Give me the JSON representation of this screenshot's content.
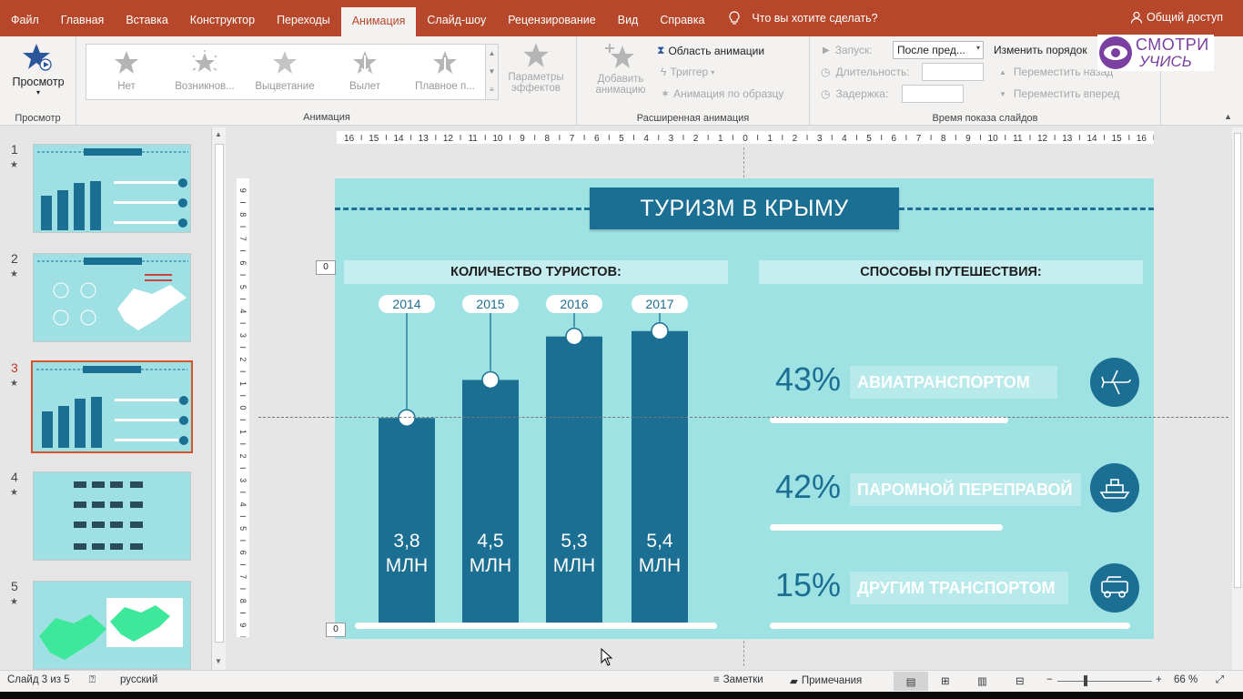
{
  "tabs": [
    "Файл",
    "Главная",
    "Вставка",
    "Конструктор",
    "Переходы",
    "Анимация",
    "Слайд-шоу",
    "Рецензирование",
    "Вид",
    "Справка"
  ],
  "active_tab": "Анимация",
  "tell_me": "Что вы хотите сделать?",
  "share": "Общий доступ",
  "ribbon": {
    "preview": {
      "label": "Просмотр",
      "group": "Просмотр"
    },
    "animation_gallery": [
      "Нет",
      "Возникнов...",
      "Выцветание",
      "Вылет",
      "Плавное п..."
    ],
    "effect_params": [
      "Параметры",
      "эффектов"
    ],
    "animation_group": "Анимация",
    "add_animation": [
      "Добавить",
      "анимацию"
    ],
    "anim_pane": "Область анимации",
    "trigger": "Триггер",
    "anim_painter": "Анимация по образцу",
    "advanced_group": "Расширенная анимация",
    "start_label": "Запуск:",
    "start_value": "После пред...",
    "duration_label": "Длительность:",
    "delay_label": "Задержка:",
    "reorder_label": "Изменить порядок",
    "move_back": "Переместить назад",
    "move_forward": "Переместить вперед",
    "timing_group": "Время показа слайдов"
  },
  "logo": {
    "line1": "СМОТРИ",
    "line2": "УЧИСЬ"
  },
  "thumbnails": [
    {
      "num": "1",
      "star": "★"
    },
    {
      "num": "2",
      "star": "★"
    },
    {
      "num": "3",
      "star": "★"
    },
    {
      "num": "4",
      "star": "★"
    },
    {
      "num": "5",
      "star": "★"
    }
  ],
  "ruler": {
    "h": [
      "16",
      "15",
      "14",
      "13",
      "12",
      "11",
      "10",
      "9",
      "8",
      "7",
      "6",
      "5",
      "4",
      "3",
      "2",
      "1",
      "0",
      "1",
      "2",
      "3",
      "4",
      "5",
      "6",
      "7",
      "8",
      "9",
      "10",
      "11",
      "12",
      "13",
      "14",
      "15",
      "16"
    ],
    "v": [
      "9",
      "8",
      "7",
      "6",
      "5",
      "4",
      "3",
      "2",
      "1",
      "0",
      "1",
      "2",
      "3",
      "4",
      "5",
      "6",
      "7",
      "8",
      "9"
    ]
  },
  "slide": {
    "title": "ТУРИЗМ В КРЫМУ",
    "left_heading": "КОЛИЧЕСТВО ТУРИСТОВ:",
    "right_heading": "СПОСОБЫ ПУТЕШЕСТВИЯ:",
    "zero_top": "0",
    "zero_bottom": "0",
    "transport": [
      {
        "pct": "43%",
        "label": "АВИАТРАНСПОРТОМ",
        "value": 43
      },
      {
        "pct": "42%",
        "label": "ПАРОМНОЙ ПЕРЕПРАВОЙ",
        "value": 42
      },
      {
        "pct": "15%",
        "label": "ДРУГИМ ТРАНСПОРТОМ",
        "value": 15
      }
    ]
  },
  "chart_data": {
    "type": "bar",
    "categories": [
      "2014",
      "2015",
      "2016",
      "2017"
    ],
    "values": [
      3.8,
      4.5,
      5.3,
      5.4
    ],
    "value_labels": [
      [
        "3,8",
        "МЛН"
      ],
      [
        "4,5",
        "МЛН"
      ],
      [
        "5,3",
        "МЛН"
      ],
      [
        "5,4",
        "МЛН"
      ]
    ],
    "title": "КОЛИЧЕСТВО ТУРИСТОВ:",
    "ylim": [
      0,
      6.2
    ]
  },
  "status": {
    "slide_count": "Слайд 3 из 5",
    "language": "русский",
    "notes": "Заметки",
    "comments": "Примечания",
    "zoom": "66 %"
  },
  "colors": {
    "accent": "#b7472a",
    "slide_bg": "#9fe2e4",
    "bar": "#1a6f93"
  }
}
